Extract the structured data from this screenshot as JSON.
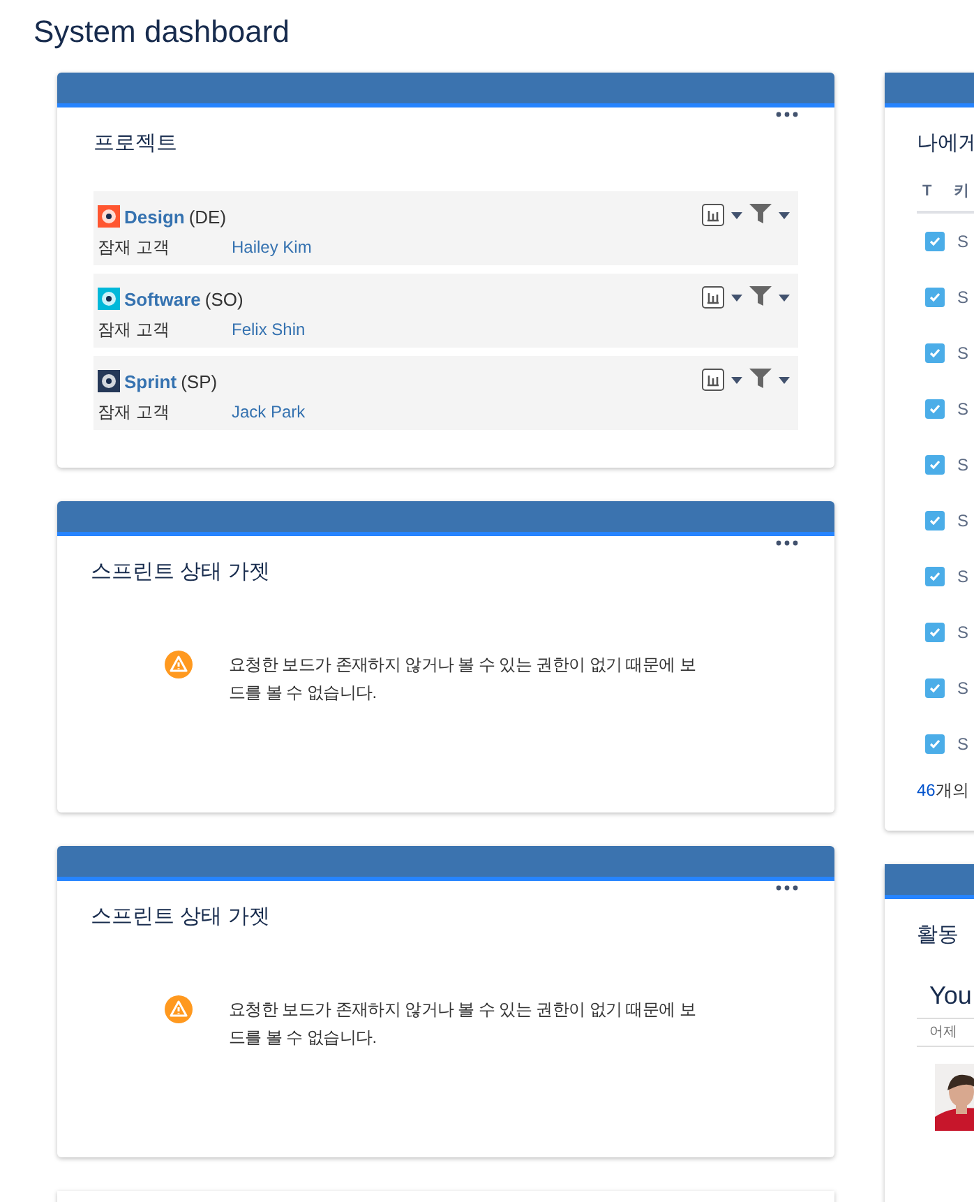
{
  "page_title": "System dashboard",
  "left_gadgets": [
    {
      "kind": "projects",
      "title": "프로젝트",
      "projects": [
        {
          "name": "Design",
          "key": "(DE)",
          "label": "잠재 고객",
          "person": "Hailey Kim",
          "color": "#ff5630"
        },
        {
          "name": "Software",
          "key": "(SO)",
          "label": "잠재 고객",
          "person": "Felix Shin",
          "color": "#00b8d9"
        },
        {
          "name": "Sprint",
          "key": "(SP)",
          "label": "잠재 고객",
          "person": "Jack Park",
          "color": "#253858"
        }
      ]
    },
    {
      "kind": "message",
      "title": "스프린트 상태 가젯",
      "message": "요청한 보드가 존재하지 않거나 볼 수 있는 권한이 없기 때문에 보드를 볼 수 없습니다."
    },
    {
      "kind": "message",
      "title": "스프린트 상태 가젯",
      "message": "요청한 보드가 존재하지 않거나 볼 수 있는 권한이 없기 때문에 보드를 볼 수 없습니다."
    },
    {
      "kind": "empty"
    }
  ],
  "right_gadgets": [
    {
      "kind": "issues",
      "title": "나에게",
      "columns": [
        "T",
        "키"
      ],
      "rows": [
        {
          "checked": true,
          "key": "S"
        },
        {
          "checked": true,
          "key": "S"
        },
        {
          "checked": true,
          "key": "S"
        },
        {
          "checked": true,
          "key": "S"
        },
        {
          "checked": true,
          "key": "S"
        },
        {
          "checked": true,
          "key": "S"
        },
        {
          "checked": true,
          "key": "S"
        },
        {
          "checked": true,
          "key": "S"
        },
        {
          "checked": true,
          "key": "S"
        },
        {
          "checked": true,
          "key": "S"
        }
      ],
      "footer_count": "46",
      "footer_text": "개의"
    },
    {
      "kind": "activity",
      "title": "활동",
      "heading": "You",
      "date": "어제"
    }
  ]
}
